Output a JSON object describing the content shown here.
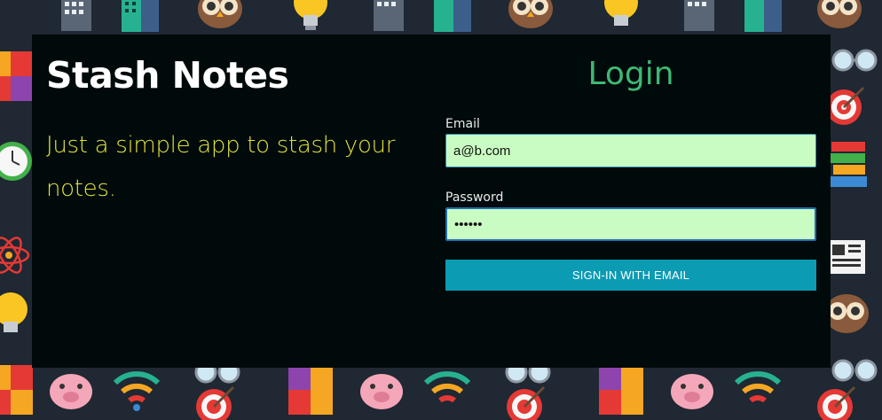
{
  "app": {
    "title": "Stash Notes",
    "tagline": "Just a simple app to stash your notes."
  },
  "login": {
    "heading": "Login",
    "email_label": "Email",
    "email_value": "a@b.com",
    "password_label": "Password",
    "password_value": "••••••",
    "signin_label": "SIGN-IN WITH EMAIL"
  },
  "colors": {
    "background_dark": "#1f2833",
    "card": "#000a0a",
    "title": "#ffffff",
    "tagline": "#e0e23a",
    "login_heading": "#3fb874",
    "input_bg": "#c9fcc2",
    "button": "#0b9bb3"
  },
  "background_icons": [
    "building-icon",
    "skyscraper-icon",
    "owl-icon",
    "lightbulb-icon",
    "puzzle-icon",
    "alarm-clock-icon",
    "atom-icon",
    "target-icon",
    "books-icon",
    "newspaper-icon",
    "glasses-icon",
    "piggy-bank-icon",
    "wifi-icon"
  ]
}
